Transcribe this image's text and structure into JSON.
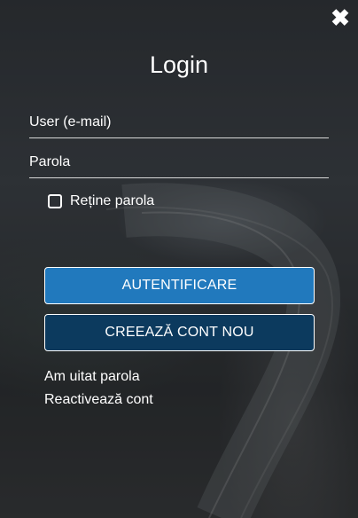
{
  "dialog": {
    "title": "Login",
    "close_icon": "close-icon"
  },
  "form": {
    "user_placeholder": "User (e-mail)",
    "user_value": "",
    "password_placeholder": "Parola",
    "password_value": "",
    "remember_label": "Reține parola",
    "remember_checked": false
  },
  "buttons": {
    "login_label": "AUTENTIFICARE",
    "create_label": "CREEAZĂ CONT NOU"
  },
  "links": {
    "forgot_password": "Am uitat parola",
    "reactivate_account": "Reactivează cont"
  },
  "colors": {
    "login_button": "#2179bd",
    "create_button": "#0c3a5e"
  }
}
